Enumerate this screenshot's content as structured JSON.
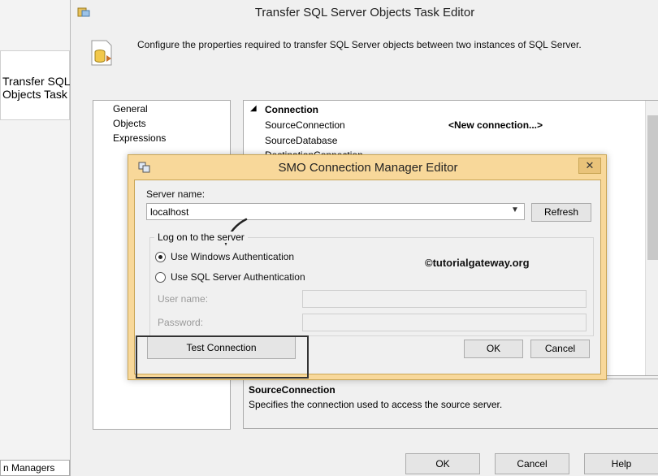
{
  "background": {
    "task_title": "Transfer SQL\nObjects Task",
    "bottom_tab": "n Managers"
  },
  "outer_dialog": {
    "title": "Transfer SQL Server Objects Task Editor",
    "description": "Configure the properties required to transfer SQL Server objects between two instances of SQL Server.",
    "nav_items": [
      "General",
      "Objects",
      "Expressions"
    ],
    "property_grid": {
      "category": "Connection",
      "rows": [
        {
          "name": "SourceConnection",
          "value": "<New connection...>"
        },
        {
          "name": "SourceDatabase",
          "value": ""
        },
        {
          "name": "DestinationConnection",
          "value": ""
        }
      ]
    },
    "property_description": {
      "title": "SourceConnection",
      "text": "Specifies the connection used to access the source server."
    },
    "buttons": {
      "ok": "OK",
      "cancel": "Cancel",
      "help": "Help"
    }
  },
  "modal": {
    "title": "SMO Connection Manager Editor",
    "close_glyph": "✕",
    "server_name_label": "Server name:",
    "server_name_value": "localhost",
    "refresh": "Refresh",
    "group_title": "Log on to the server",
    "windows_auth": "Use Windows Authentication",
    "sql_auth": "Use SQL Server Authentication",
    "auth_selected": "windows",
    "user_name_label": "User name:",
    "password_label": "Password:",
    "watermark": "©tutorialgateway.org",
    "test_connection": "Test  Connection",
    "ok": "OK",
    "cancel": "Cancel"
  },
  "colors": {
    "modal_frame": "#f8d89a",
    "dialog_bg": "#f0f0f0",
    "annotation": "#333333"
  }
}
